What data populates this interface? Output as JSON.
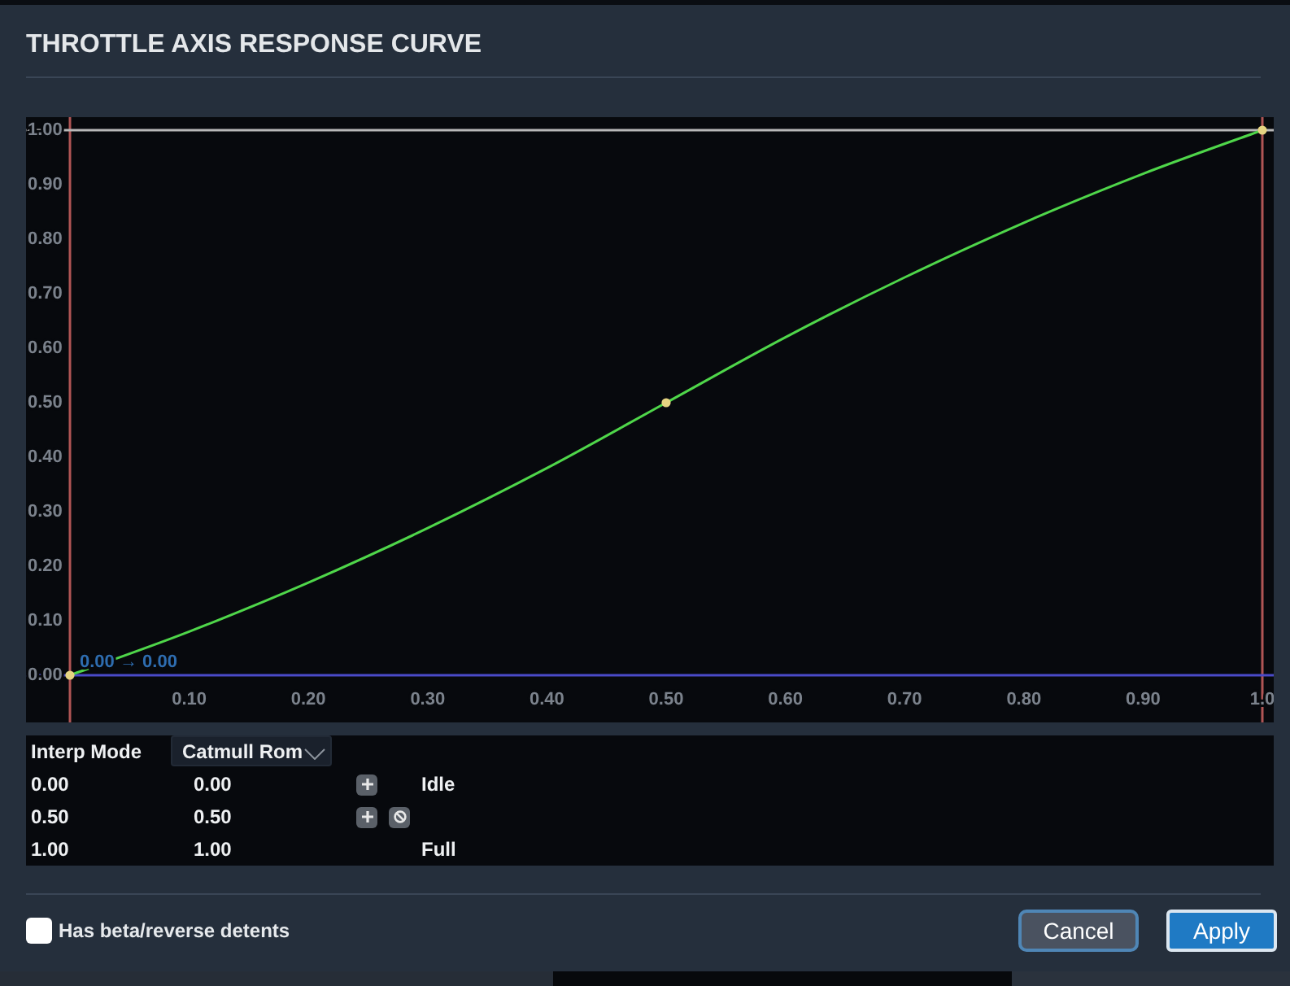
{
  "dialog": {
    "title": "THROTTLE AXIS RESPONSE CURVE"
  },
  "chart": {
    "chart_data": {
      "type": "line",
      "x": [
        0,
        0.1,
        0.2,
        0.3,
        0.4,
        0.5,
        0.6,
        0.7,
        0.8,
        0.9,
        1
      ],
      "values": [
        0,
        0.08,
        0.17,
        0.27,
        0.38,
        0.5,
        0.62,
        0.73,
        0.83,
        0.92,
        1
      ],
      "xlim": [
        0,
        1
      ],
      "ylim": [
        0,
        1
      ],
      "xticks": [
        {
          "value": 0.1,
          "label": "0.10"
        },
        {
          "value": 0.2,
          "label": "0.20"
        },
        {
          "value": 0.3,
          "label": "0.30"
        },
        {
          "value": 0.4,
          "label": "0.40"
        },
        {
          "value": 0.5,
          "label": "0.50"
        },
        {
          "value": 0.6,
          "label": "0.60"
        },
        {
          "value": 0.7,
          "label": "0.70"
        },
        {
          "value": 0.8,
          "label": "0.80"
        },
        {
          "value": 0.9,
          "label": "0.90"
        },
        {
          "value": 1,
          "label": "1.0"
        }
      ],
      "yticks": [
        {
          "value": 0,
          "label": "0.00"
        },
        {
          "value": 0.1,
          "label": "0.10"
        },
        {
          "value": 0.2,
          "label": "0.20"
        },
        {
          "value": 0.3,
          "label": "0.30"
        },
        {
          "value": 0.4,
          "label": "0.40"
        },
        {
          "value": 0.5,
          "label": "0.50"
        },
        {
          "value": 0.6,
          "label": "0.60"
        },
        {
          "value": 0.7,
          "label": "0.70"
        },
        {
          "value": 0.8,
          "label": "0.80"
        },
        {
          "value": 0.9,
          "label": "0.90"
        },
        {
          "value": 1,
          "label": "1.00"
        }
      ],
      "annotations": [
        {
          "text": "0.00 → 0.00",
          "x": 0,
          "y": 0
        }
      ]
    }
  },
  "points_table": {
    "interp_mode": {
      "label": "Interp Mode",
      "value": "Catmull Rom"
    },
    "rows": [
      {
        "input": "0.00",
        "output": "0.00",
        "actions": [
          {
            "kind": "add"
          }
        ],
        "label": "Idle"
      },
      {
        "input": "0.50",
        "output": "0.50",
        "actions": [
          {
            "kind": "add"
          },
          {
            "kind": "remove"
          }
        ]
      },
      {
        "input": "1.00",
        "output": "1.00",
        "label": "Full"
      }
    ]
  },
  "footer": {
    "checkbox": {
      "label": "Has beta/reverse detents",
      "checked": false
    },
    "buttons": [
      {
        "label": "Cancel",
        "kind": "secondary"
      },
      {
        "label": "Apply",
        "kind": "primary"
      }
    ]
  }
}
